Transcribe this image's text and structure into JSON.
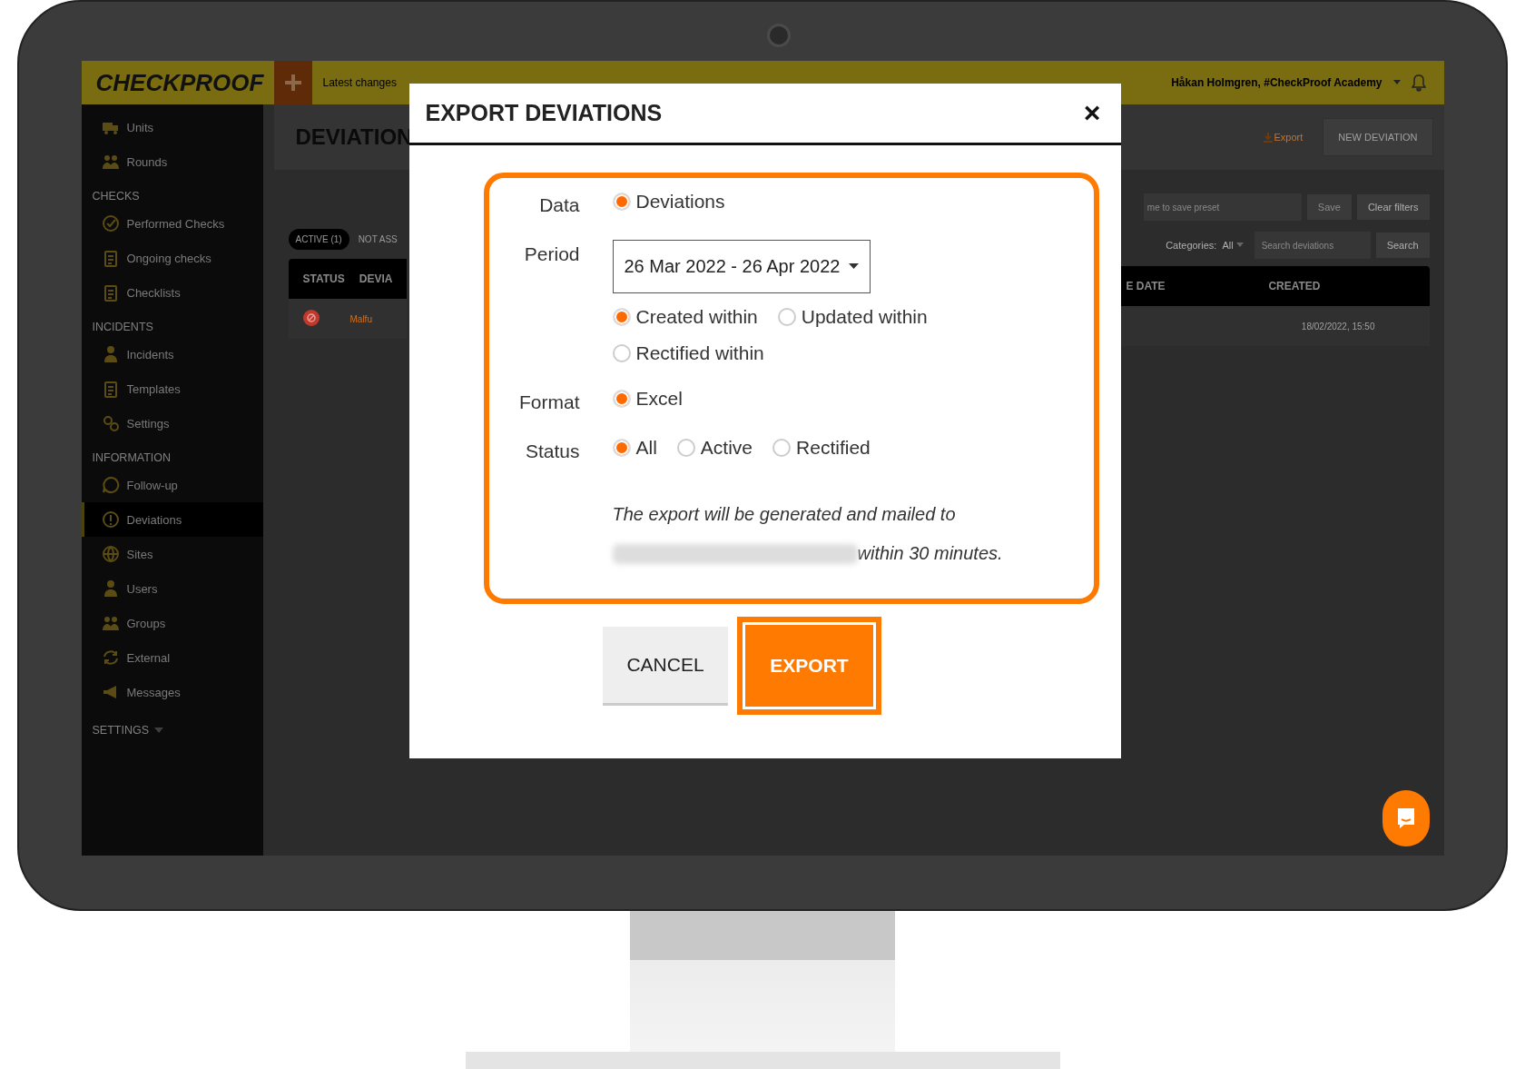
{
  "app": {
    "logo": "CHECKPROOF",
    "latest_changes": "Latest changes",
    "user": "Håkan Holmgren, #CheckProof Academy"
  },
  "sidebar": {
    "items": [
      {
        "kind": "link",
        "label": "Units",
        "selected": false
      },
      {
        "kind": "link",
        "label": "Rounds",
        "selected": false
      },
      {
        "kind": "heading",
        "label": "CHECKS"
      },
      {
        "kind": "link",
        "label": "Performed Checks",
        "selected": false
      },
      {
        "kind": "link",
        "label": "Ongoing checks",
        "selected": false
      },
      {
        "kind": "link",
        "label": "Checklists",
        "selected": false
      },
      {
        "kind": "heading",
        "label": "INCIDENTS"
      },
      {
        "kind": "link",
        "label": "Incidents",
        "selected": false
      },
      {
        "kind": "link",
        "label": "Templates",
        "selected": false
      },
      {
        "kind": "link",
        "label": "Settings",
        "selected": false
      },
      {
        "kind": "heading",
        "label": "INFORMATION"
      },
      {
        "kind": "link",
        "label": "Follow-up",
        "selected": false
      },
      {
        "kind": "link",
        "label": "Deviations",
        "selected": true
      },
      {
        "kind": "link",
        "label": "Sites",
        "selected": false
      },
      {
        "kind": "link",
        "label": "Users",
        "selected": false
      },
      {
        "kind": "link",
        "label": "Groups",
        "selected": false
      },
      {
        "kind": "link",
        "label": "External",
        "selected": false
      },
      {
        "kind": "link",
        "label": "Messages",
        "selected": false
      },
      {
        "kind": "dropdown",
        "label": "SETTINGS"
      }
    ]
  },
  "main": {
    "title": "DEVIATION",
    "export_link": "Export",
    "new_button": "NEW DEVIATION",
    "tabs": [
      {
        "label": "ACTIVE (1)",
        "selected": true
      },
      {
        "label": "NOT ASS",
        "selected": false
      }
    ],
    "filters": {
      "preset_placeholder": "me to save preset",
      "save_button": "Save",
      "clear_button": "Clear filters",
      "categories_label": "Categories:",
      "categories_value": "All",
      "search_placeholder": "Search deviations",
      "search_button": "Search"
    },
    "table": {
      "columns_left": [
        "STATUS",
        "DEVIA"
      ],
      "columns_right": [
        "E DATE",
        "CREATED"
      ],
      "rows": [
        {
          "column_2": "Malfu",
          "created": "18/02/2022, 15:50"
        }
      ]
    }
  },
  "dialog": {
    "title": "EXPORT DEVIATIONS",
    "close": "×",
    "fields": [
      {
        "kind": "radios",
        "label": "Data",
        "options": [
          {
            "label": "Deviations",
            "selected": true
          }
        ]
      },
      {
        "kind": "period",
        "label": "Period",
        "value": "26 Mar 2022 - 26 Apr 2022",
        "options": [
          {
            "label": "Created within",
            "selected": true
          },
          {
            "label": "Updated within",
            "selected": false
          },
          {
            "label": "Rectified within",
            "selected": false
          }
        ]
      },
      {
        "kind": "radios",
        "label": "Format",
        "options": [
          {
            "label": "Excel",
            "selected": true
          }
        ]
      },
      {
        "kind": "radios",
        "label": "Status",
        "options": [
          {
            "label": "All",
            "selected": true
          },
          {
            "label": "Active",
            "selected": false
          },
          {
            "label": "Rectified",
            "selected": false
          }
        ]
      }
    ],
    "note": "The export will be generated and mailed to",
    "note_end": "within 30 minutes.",
    "cancel_button": "CANCEL",
    "export_button": "EXPORT"
  }
}
